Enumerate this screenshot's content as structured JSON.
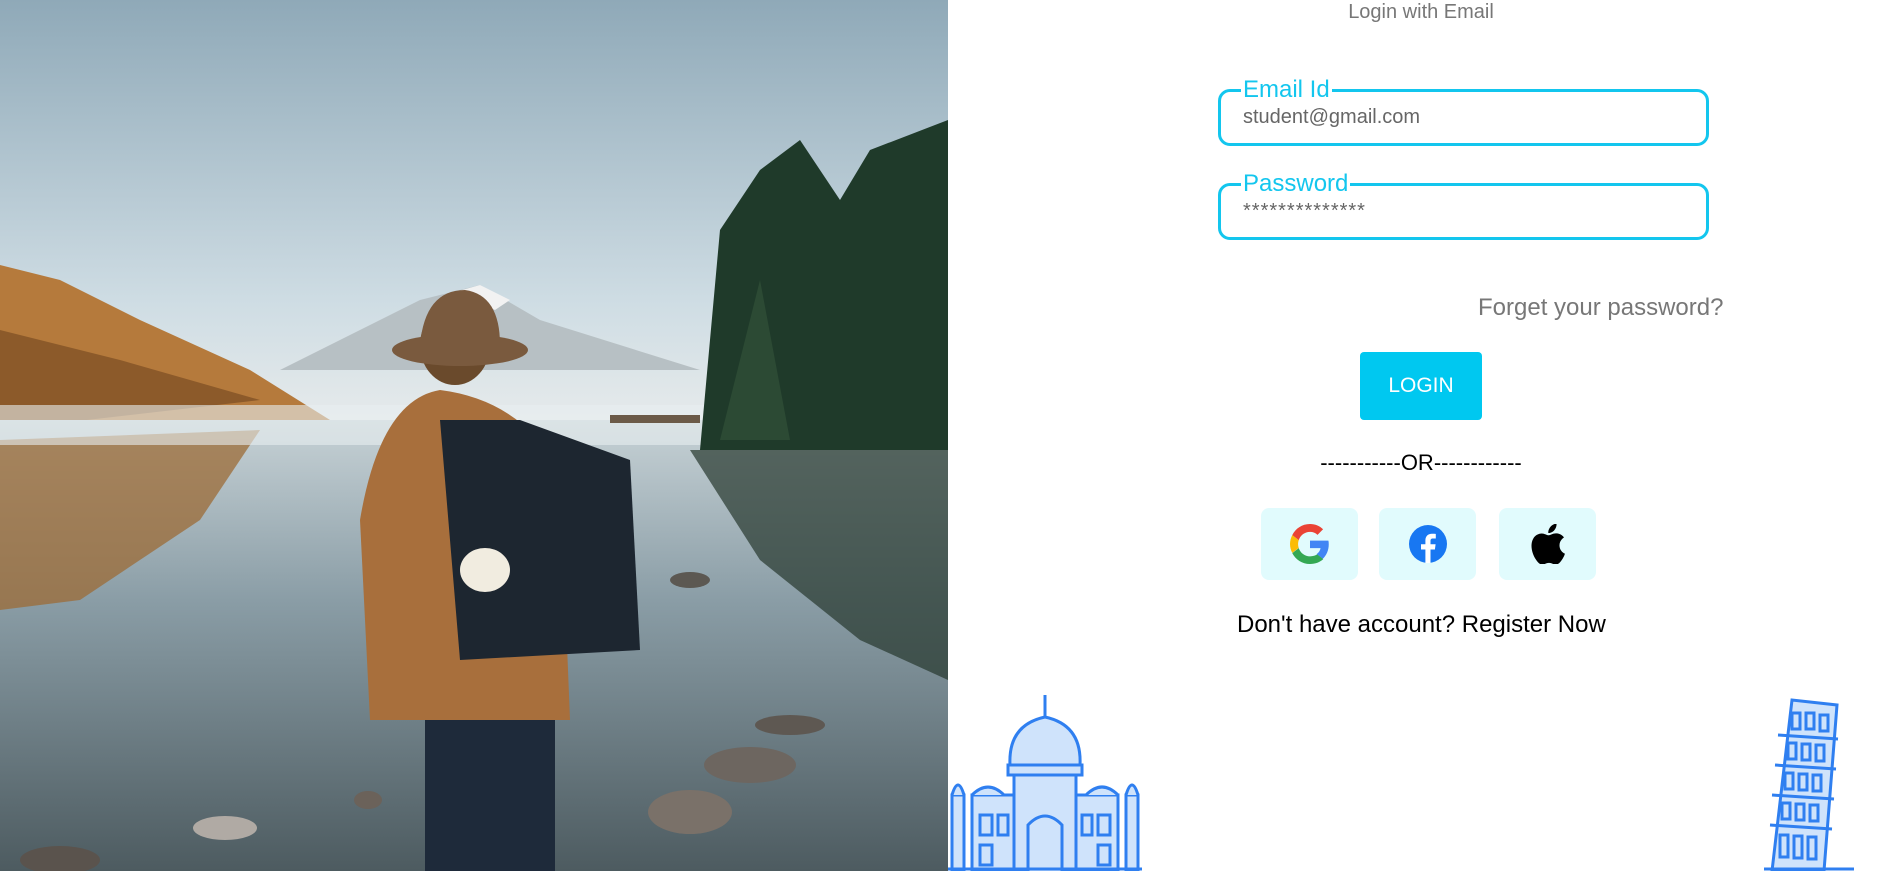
{
  "header": {
    "subtitle": "Login with Email"
  },
  "form": {
    "email": {
      "label": "Email Id",
      "value": "student@gmail.com"
    },
    "password": {
      "label": "Password",
      "value": "**************"
    },
    "forgot_label": "Forget your password?",
    "login_label": "LOGIN"
  },
  "divider": "-----------OR------------",
  "social": [
    {
      "icon": "google-icon"
    },
    {
      "icon": "facebook-icon"
    },
    {
      "icon": "apple-icon"
    }
  ],
  "register": {
    "prompt": "Don't have account? ",
    "link": "Register Now"
  },
  "colors": {
    "accent": "#13c6ee",
    "button": "#00c8f0",
    "social_bg": "#e1fbfd",
    "monument": "#2f7ff0"
  }
}
